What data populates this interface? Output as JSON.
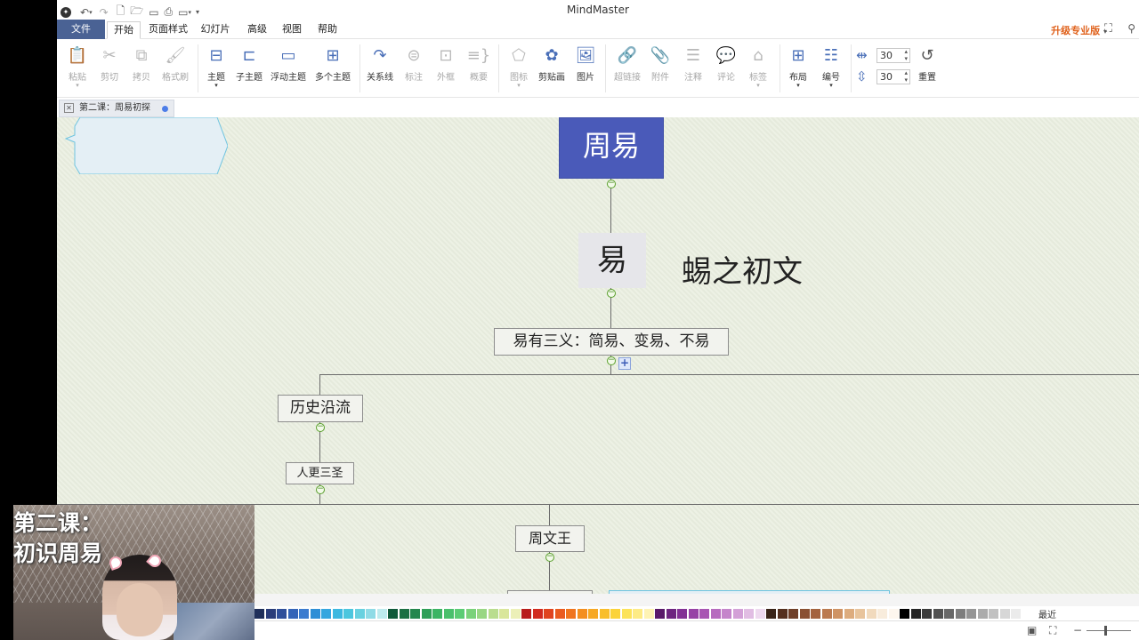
{
  "app_title": "MindMaster",
  "menu": {
    "file": "文件",
    "tabs": [
      "开始",
      "页面样式",
      "幻灯片",
      "高级",
      "视图",
      "帮助"
    ],
    "upgrade": "升级专业版"
  },
  "ribbon": {
    "paste": "粘贴",
    "cut": "剪切",
    "copy": "拷贝",
    "format_painter": "格式刷",
    "topic": "主题",
    "subtopic": "子主题",
    "floating_topic": "浮动主题",
    "multiple_topics": "多个主题",
    "relationship": "关系线",
    "callout": "标注",
    "boundary": "外框",
    "summary": "概要",
    "icon": "图标",
    "clipart": "剪贴画",
    "picture": "图片",
    "hyperlink": "超链接",
    "attachment": "附件",
    "note": "注释",
    "comment": "评论",
    "tag": "标签",
    "layout": "布局",
    "numbering": "编号",
    "h_spacing": "30",
    "v_spacing": "30",
    "reset": "重置"
  },
  "document_tab": "第二课：周易初探",
  "mindmap": {
    "root": "周易",
    "yi": "易",
    "callout": "蜴之初文",
    "three_meanings": "易有三义：简易、变易、不易",
    "history": "历史沿流",
    "three_saints": "人更三圣",
    "king_wen": "周文王"
  },
  "overlay": {
    "title_line1": "第二课：",
    "title_line2": "初识周易"
  },
  "palette": {
    "recent_label": "最近",
    "colors": [
      "#1f2f5a",
      "#2a3d7a",
      "#2f4f9a",
      "#3464b8",
      "#3b7bcf",
      "#2f8fd6",
      "#35a6df",
      "#3cb8e0",
      "#4cc6de",
      "#68d1e0",
      "#8fdbe6",
      "#bdebee",
      "#0f5a3a",
      "#1c7044",
      "#25874e",
      "#2f9f58",
      "#3cb464",
      "#49c06c",
      "#5bcc74",
      "#7ad27a",
      "#99d784",
      "#b9dd8e",
      "#d9e69b",
      "#ecf0b8",
      "#b81c1c",
      "#d12a1f",
      "#e0441f",
      "#ea5b1f",
      "#f0751e",
      "#f48f1f",
      "#f7a823",
      "#f9be2b",
      "#fbd33a",
      "#fce35a",
      "#fdeb85",
      "#fef3b4",
      "#5a1a6a",
      "#6e2580",
      "#833195",
      "#9741a6",
      "#a855b3",
      "#b76bbf",
      "#c585cb",
      "#d3a0d7",
      "#e1bde3",
      "#eed9ef",
      "#3a2418",
      "#55301f",
      "#6f3f28",
      "#8a5033",
      "#a4633f",
      "#bb7a50",
      "#cf9364",
      "#ddac7e",
      "#e8c49c",
      "#f1dabd",
      "#f8ecdc",
      "#fdf6ee",
      "#000000",
      "#262626",
      "#3c3c3c",
      "#525252",
      "#686868",
      "#7e7e7e",
      "#959595",
      "#ababab",
      "#c1c1c1",
      "#d7d7d7",
      "#ebebeb",
      "#ffffff"
    ]
  }
}
